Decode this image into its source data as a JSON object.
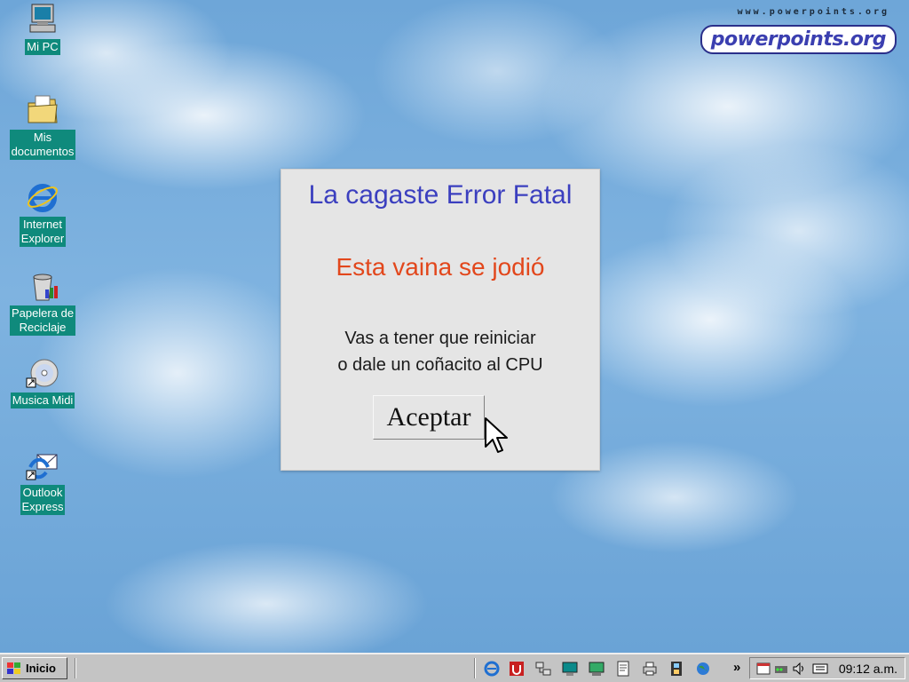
{
  "desktop": {
    "icons": [
      {
        "label": "Mi PC",
        "icon": "computer-icon"
      },
      {
        "label": "Mis\ndocumentos",
        "icon": "folder-documents-icon"
      },
      {
        "label": "Internet\nExplorer",
        "icon": "internet-explorer-icon"
      },
      {
        "label": "Papelera de\nReciclaje",
        "icon": "recycle-bin-icon"
      },
      {
        "label": "Musica Midi",
        "icon": "cd-music-shortcut-icon"
      },
      {
        "label": "Outlook\nExpress",
        "icon": "outlook-express-shortcut-icon"
      }
    ],
    "branding": {
      "url_text": "www.powerpoints.org",
      "logo_text": "powerpoints.org"
    }
  },
  "dialog": {
    "title": "La cagaste Error Fatal",
    "subtitle": "Esta vaina se jodió",
    "message_line1": "Vas a tener que reiniciar",
    "message_line2": "o dale un coñacito al CPU",
    "button_label": "Aceptar"
  },
  "taskbar": {
    "start_label": "Inicio",
    "quick_launch": [
      "internet-explorer-icon",
      "antivirus-icon",
      "network-icon",
      "display-icon",
      "monitor-icon",
      "notepad-icon",
      "printer-icon",
      "film-icon",
      "globe-icon"
    ],
    "overflow_label": "»",
    "tray_icons": [
      "scheduler-icon",
      "modem-icon",
      "volume-icon",
      "keyboard-icon"
    ],
    "clock": "09:12 a.m."
  },
  "colors": {
    "title": "#3b3fbf",
    "subtitle": "#e2471c",
    "icon_label_bg": "#0f8a7c",
    "taskbar": "#c4c4c4"
  }
}
